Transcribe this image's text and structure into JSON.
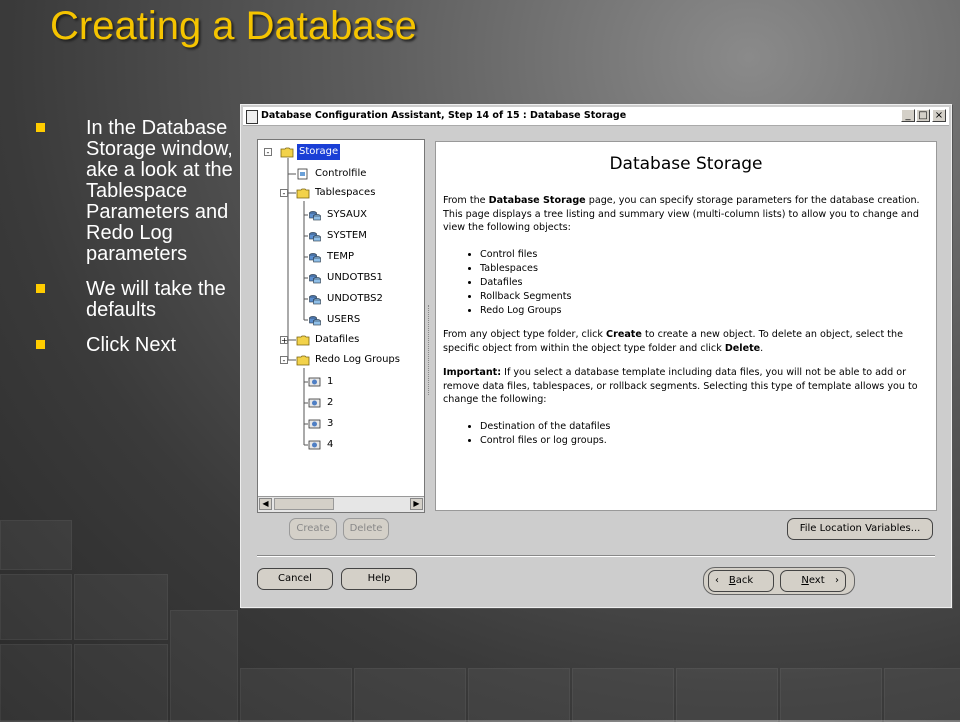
{
  "slide": {
    "title": "Creating a Database",
    "bullets": [
      "In the Database Storage window, ake a look at the Tablespace Parameters and Redo Log parameters",
      "We will take the defaults",
      "Click Next"
    ]
  },
  "window": {
    "title": "Database Configuration Assistant, Step 14 of 15 : Database Storage",
    "controls": {
      "minimize": "_",
      "maximize": "□",
      "close": "×"
    }
  },
  "tree": {
    "nodes": [
      {
        "label": "Storage",
        "icon": "folder-icon",
        "selected": true
      },
      {
        "label": "Controlfile",
        "icon": "controlfile-icon"
      },
      {
        "label": "Tablespaces",
        "icon": "folder-icon"
      },
      {
        "label": "SYSAUX",
        "icon": "tablespace-icon"
      },
      {
        "label": "SYSTEM",
        "icon": "tablespace-icon"
      },
      {
        "label": "TEMP",
        "icon": "tablespace-icon"
      },
      {
        "label": "UNDOTBS1",
        "icon": "tablespace-icon"
      },
      {
        "label": "UNDOTBS2",
        "icon": "tablespace-icon"
      },
      {
        "label": "USERS",
        "icon": "tablespace-icon"
      },
      {
        "label": "Datafiles",
        "icon": "folder-icon"
      },
      {
        "label": "Redo Log Groups",
        "icon": "folder-icon"
      },
      {
        "label": "1",
        "icon": "redo-log-icon"
      },
      {
        "label": "2",
        "icon": "redo-log-icon"
      },
      {
        "label": "3",
        "icon": "redo-log-icon"
      },
      {
        "label": "4",
        "icon": "redo-log-icon"
      }
    ]
  },
  "content": {
    "heading": "Database Storage",
    "p1": {
      "a": "From the ",
      "b": "Database Storage",
      "c": " page, you can specify storage parameters for the database creation. This page displays a tree listing and summary view (multi-column lists) to allow you to change and view the following objects:"
    },
    "list1": [
      "Control files",
      "Tablespaces",
      "Datafiles",
      "Rollback Segments",
      "Redo Log Groups"
    ],
    "p2": {
      "a": "From any object type folder, click ",
      "b": "Create",
      "c": " to create a new object. To delete an object, select the specific object from within the object type folder and click ",
      "d": "Delete",
      "e": "."
    },
    "p3": {
      "b": "Important:",
      "c": " If you select a database template including data files, you will not be able to add or remove data files, tablespaces, or rollback segments. Selecting this type of template allows you to change the following:"
    },
    "list2": [
      "Destination of the datafiles",
      "Control files or log groups."
    ]
  },
  "buttons": {
    "create": "Create",
    "delete": "Delete",
    "file_location": "File Location Variables...",
    "cancel": "Cancel",
    "help": "Help",
    "back_first": "B",
    "back_rest": "ack",
    "next_first": "N",
    "next_rest": "ext"
  },
  "colors": {
    "title": "#f5c400",
    "selection": "#1a3fd6",
    "bullet": "#ffcc00"
  }
}
